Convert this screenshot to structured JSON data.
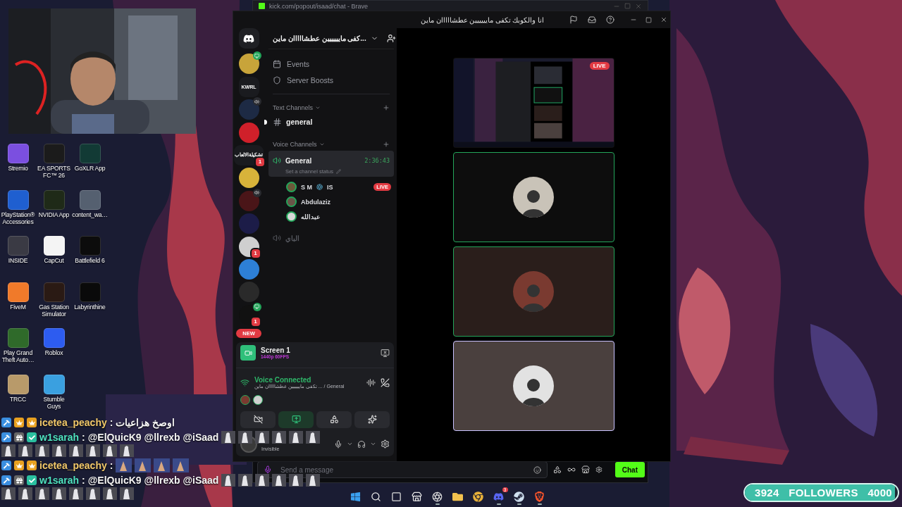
{
  "desktop_icons": [
    [
      {
        "label": "Stremio",
        "color": "#7b4fe0"
      },
      {
        "label": "EA SPORTS FC™ 26",
        "color": "#1b1b1b"
      },
      {
        "label": "GoXLR App",
        "color": "#123a35"
      }
    ],
    [
      {
        "label": "PlayStation® Accessories",
        "color": "#1f5fd0"
      },
      {
        "label": "NVIDIA App",
        "color": "#1f2a18"
      },
      {
        "label": "content_wa…",
        "color": "#556070"
      }
    ],
    [
      {
        "label": "INSIDE",
        "color": "#3a3a44"
      },
      {
        "label": "CapCut",
        "color": "#f4f4f4"
      },
      {
        "label": "Battlefield 6",
        "color": "#0c0c0c"
      }
    ],
    [
      {
        "label": "FiveM",
        "color": "#f07a2a"
      },
      {
        "label": "Gas Station Simulator",
        "color": "#2a1a14"
      },
      {
        "label": "Labyrinthine",
        "color": "#0a0a0a"
      }
    ],
    [
      {
        "label": "Play Grand Theft Auto…",
        "color": "#2f6a2a"
      },
      {
        "label": "Roblox",
        "color": "#2d5cf0"
      }
    ],
    [
      {
        "label": "TRCC",
        "color": "#b89a6a"
      },
      {
        "label": "Stumble Guys",
        "color": "#3aa0e0"
      }
    ]
  ],
  "browser": {
    "title": "kick.com/popout/isaad/chat - Brave",
    "message_placeholder": "Send a message",
    "chat_button": "Chat"
  },
  "discord": {
    "title": "انا والكوبك تكفى مايييييين عطشااااان ماين",
    "servers": [
      {
        "kind": "home"
      },
      {
        "kind": "avatar",
        "color": "#c8a43a",
        "status": {
          "kind": "screen"
        }
      },
      {
        "kind": "text",
        "label": "KWRL"
      },
      {
        "kind": "avatar",
        "color": "#1d2a44",
        "status": {
          "kind": "voice"
        }
      },
      {
        "kind": "avatar",
        "color": "#d0202a"
      },
      {
        "kind": "text",
        "label": "تشكيلةالالعاب",
        "badge": "1"
      },
      {
        "kind": "avatar",
        "color": "#d8b33a"
      },
      {
        "kind": "avatar",
        "color": "#4a1518",
        "status": {
          "kind": "voice"
        }
      },
      {
        "kind": "avatar",
        "color": "#1c1c48"
      },
      {
        "kind": "avatar",
        "color": "#cfcfcf",
        "badge": "1"
      },
      {
        "kind": "avatar",
        "color": "#2d7fd6"
      },
      {
        "kind": "avatar",
        "color": "#2a2a2a"
      },
      {
        "kind": "avatar",
        "color": "#111111",
        "status": {
          "kind": "screen"
        },
        "badge": "1"
      }
    ],
    "new_badge": "NEW",
    "server_name": "...كفى مايييييين عطشااااان ماين",
    "nav": [
      {
        "kind": "events",
        "label": "Events"
      },
      {
        "kind": "boosts",
        "label": "Server Boosts"
      }
    ],
    "text_category": "Text Channels",
    "text_channels": [
      {
        "name": "general",
        "unread": true
      }
    ],
    "voice_category": "Voice Channels",
    "voice_channels": [
      {
        "name": "General",
        "selected": true,
        "timer": "2:36:43",
        "status": "Set a channel status",
        "members": [
          {
            "name": "S M",
            "tag": "IS",
            "live": "LIVE",
            "color": "#6b5a3a"
          },
          {
            "name": "Abdulaziz",
            "color": "#6a5448"
          },
          {
            "name": "عبدالله",
            "color": "#d8d8d8"
          }
        ]
      },
      {
        "name": "الباي",
        "selected": false
      }
    ],
    "tiles": [
      {
        "kind": "stream",
        "live": "LIVE",
        "speaking": false,
        "selected": false
      },
      {
        "kind": "avatar",
        "color": "#c9c3b8",
        "speaking": true,
        "selected": false
      },
      {
        "kind": "avatar",
        "color": "#7a3a30",
        "speaking": true,
        "selected": false
      },
      {
        "kind": "avatar",
        "color": "#e2e2e2",
        "speaking": false,
        "selected": true
      }
    ],
    "screen_share": {
      "title": "Screen 1",
      "quality": "1440p 60FPS"
    },
    "voice": {
      "status": "Voice Connected",
      "channel": "General / ... تكفى مايييييين عطشااااان ماين",
      "participants": [
        {
          "color": "#7a3a30"
        },
        {
          "color": "#d0d0d0"
        }
      ]
    },
    "actions": [
      {
        "kind": "camera",
        "active": false
      },
      {
        "kind": "screen",
        "active": true
      },
      {
        "kind": "activities",
        "active": false
      },
      {
        "kind": "soundboard",
        "active": false
      }
    ],
    "user": {
      "status": "Invisible"
    }
  },
  "chat": [
    {
      "user": "icetea_peachy",
      "color": "#f1c86a",
      "badges": [
        {
          "kind": "mod"
        },
        {
          "kind": "sub"
        },
        {
          "kind": "crown"
        }
      ],
      "separator": ":",
      "text": "اوصخ هزاعيات"
    },
    {
      "user": "w1sarah",
      "color": "#4fe3c1",
      "badges": [
        {
          "kind": "mod"
        },
        {
          "kind": "gift"
        },
        {
          "kind": "verified"
        }
      ],
      "separator": ":",
      "text": "@ElQuicK9 @llrexb @iSaad",
      "emotes": [
        {
          "kind": "ghost"
        },
        {
          "kind": "ghost"
        },
        {
          "kind": "ghost"
        },
        {
          "kind": "ghost"
        },
        {
          "kind": "ghost"
        },
        {
          "kind": "ghost"
        },
        {
          "kind": "ghost"
        },
        {
          "kind": "ghost"
        },
        {
          "kind": "ghost"
        },
        {
          "kind": "ghost"
        },
        {
          "kind": "ghost"
        },
        {
          "kind": "ghost"
        },
        {
          "kind": "ghost"
        },
        {
          "kind": "ghost"
        }
      ]
    },
    {
      "user": "icetea_peachy",
      "color": "#f1c86a",
      "badges": [
        {
          "kind": "mod"
        },
        {
          "kind": "sub"
        },
        {
          "kind": "crown"
        }
      ],
      "separator": ":",
      "emotes": [
        {
          "kind": "art"
        },
        {
          "kind": "art"
        },
        {
          "kind": "art"
        },
        {
          "kind": "art"
        }
      ]
    },
    {
      "user": "w1sarah",
      "color": "#4fe3c1",
      "badges": [
        {
          "kind": "mod"
        },
        {
          "kind": "gift"
        },
        {
          "kind": "verified"
        }
      ],
      "separator": ":",
      "text": "@ElQuicK9 @llrexb @iSaad",
      "emotes": [
        {
          "kind": "ghost"
        },
        {
          "kind": "ghost"
        },
        {
          "kind": "ghost"
        },
        {
          "kind": "ghost"
        },
        {
          "kind": "ghost"
        },
        {
          "kind": "ghost"
        },
        {
          "kind": "ghost"
        },
        {
          "kind": "ghost"
        },
        {
          "kind": "ghost"
        },
        {
          "kind": "ghost"
        },
        {
          "kind": "ghost"
        },
        {
          "kind": "ghost"
        },
        {
          "kind": "ghost"
        },
        {
          "kind": "ghost"
        }
      ]
    }
  ],
  "taskbar": [
    {
      "kind": "start",
      "running": false
    },
    {
      "kind": "search",
      "running": false
    },
    {
      "kind": "taskview",
      "running": false
    },
    {
      "kind": "store",
      "running": false
    },
    {
      "kind": "recorder",
      "running": true
    },
    {
      "kind": "explorer",
      "running": false
    },
    {
      "kind": "chrome",
      "running": false
    },
    {
      "kind": "discord",
      "running": true,
      "badge": "3"
    },
    {
      "kind": "steam",
      "running": true
    },
    {
      "kind": "brave",
      "running": true
    }
  ],
  "follower_goal": {
    "current": "3924",
    "label": "FOLLOWERS",
    "target": "4000",
    "level": 0.98
  }
}
